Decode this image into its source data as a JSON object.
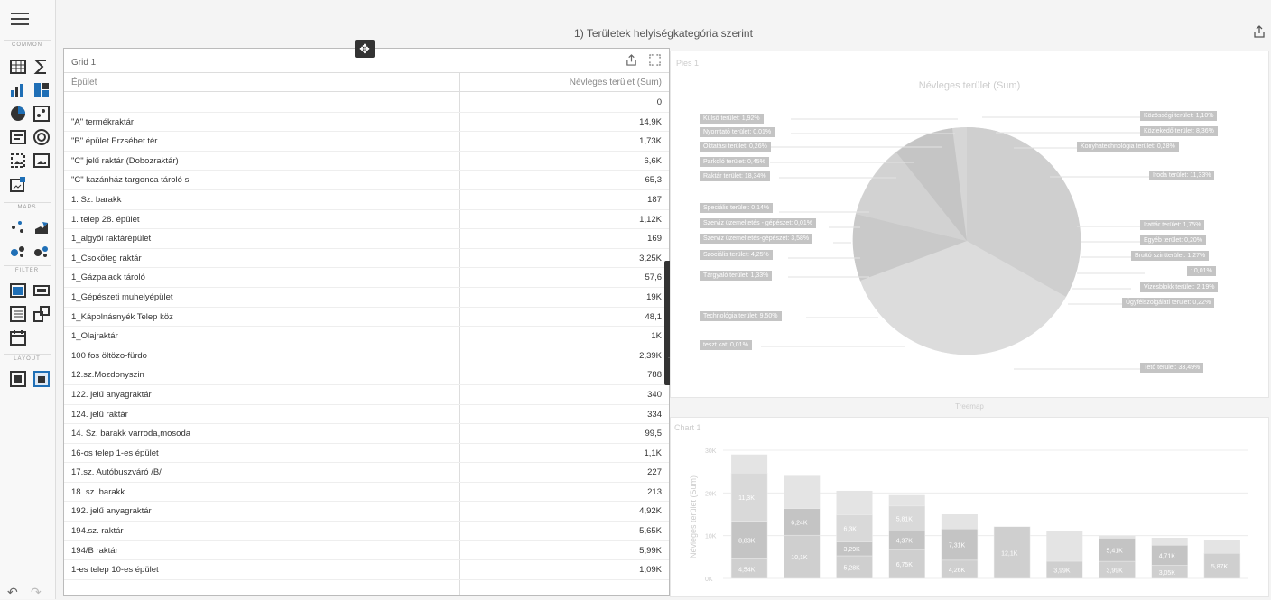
{
  "toolbox": {
    "sections": {
      "common": "COMMON",
      "maps": "MAPS",
      "filter": "FILTER",
      "layout": "LAYOUT"
    }
  },
  "dashboard": {
    "title": "1) Területek helyiségkategória szerint"
  },
  "grid": {
    "caption": "Grid 1",
    "col1": "Épület",
    "col2": "Névleges terület (Sum)",
    "rows": [
      {
        "name": "",
        "value": "0"
      },
      {
        "name": "\"A\" termékraktár",
        "value": "14,9K"
      },
      {
        "name": "\"B\" épület Erzsébet tér",
        "value": "1,73K"
      },
      {
        "name": "\"C\" jelű raktár (Dobozraktár)",
        "value": "6,6K"
      },
      {
        "name": "\"C\" kazánház targonca tároló s",
        "value": "65,3"
      },
      {
        "name": "1. Sz. barakk",
        "value": "187"
      },
      {
        "name": "1. telep 28. épület",
        "value": "1,12K"
      },
      {
        "name": "1_algyői raktárépület",
        "value": "169"
      },
      {
        "name": "1_Csoköteg raktár",
        "value": "3,25K"
      },
      {
        "name": "1_Gázpalack tároló",
        "value": "57,6"
      },
      {
        "name": "1_Gépészeti muhelyépület",
        "value": "19K"
      },
      {
        "name": "1_Kápolnásnyék Telep köz",
        "value": "48,1"
      },
      {
        "name": "1_Olajraktár",
        "value": "1K"
      },
      {
        "name": "100 fos öltözo-fürdo",
        "value": "2,39K"
      },
      {
        "name": "12.sz.Mozdonyszin",
        "value": "788"
      },
      {
        "name": "122. jelű anyagraktár",
        "value": "340"
      },
      {
        "name": "124. jelű raktár",
        "value": "334"
      },
      {
        "name": "14. Sz. barakk varroda,mosoda",
        "value": "99,5"
      },
      {
        "name": "16-os telep 1-es épület",
        "value": "1,1K"
      },
      {
        "name": "17.sz. Autóbuszváró /B/",
        "value": "227"
      },
      {
        "name": "18. sz. barakk",
        "value": "213"
      },
      {
        "name": "192. jelű anyagraktár",
        "value": "4,92K"
      },
      {
        "name": "194.sz. raktár",
        "value": "5,65K"
      },
      {
        "name": "194/B raktár",
        "value": "5,99K"
      },
      {
        "name": "1-es telep 10-es épület",
        "value": "1,09K"
      }
    ]
  },
  "pie": {
    "caption": "Pies 1",
    "title": "Névleges terület (Sum)",
    "labels_left": [
      "Külső terület: 1,92%",
      "Nyomtató terület: 0,01%",
      "Oktatási terület: 0,26%",
      "Parkoló terület: 0,45%",
      "Raktár terület: 18,34%",
      "Speciális terület: 0,14%",
      "Szerviz üzemeltetés - gépészet: 0,01%",
      "Szerviz üzemeltetés-gépészet: 3,58%",
      "Szociális terület: 4,25%",
      "Tárgyaló terület: 1,33%",
      "Technológia terület: 9,50%",
      "teszt kat: 0,01%"
    ],
    "labels_right": [
      "Közösségi terület: 1,10%",
      "Közlekedő terület: 8,36%",
      "Konyhatechnológia terület: 0,28%",
      "Iroda terület: 11,33%",
      "Irattár terület: 1,75%",
      "Egyéb terület: 0,20%",
      "Bruttó szintterület: 1,27%",
      ": 0,01%",
      "Vizesblokk terület: 2,19%",
      "Ügyfélszolgálati terület: 0,22%",
      "Tető terület: 33,49%"
    ]
  },
  "treemap": {
    "tab": "Treemap"
  },
  "chart1": {
    "caption": "Chart 1"
  },
  "chart_data": {
    "type": "bar",
    "stacked": true,
    "ylabel": "Névleges terület (Sum)",
    "yticks": [
      "0K",
      "10K",
      "20K",
      "30K"
    ],
    "ylim": [
      0,
      30000
    ],
    "totals": [
      29000,
      24000,
      20500,
      19500,
      15000,
      12000,
      11000,
      10000,
      9500,
      9000
    ],
    "segment_labels": [
      [
        "4,54K",
        "8,83K",
        "11,3K"
      ],
      [
        "10,1K",
        "6,24K"
      ],
      [
        "5,28K",
        "3,29K",
        "6,3K"
      ],
      [
        "6,75K",
        "4,37K",
        "5,81K"
      ],
      [
        "4,26K",
        "7,31K"
      ],
      [
        "12,1K"
      ],
      [
        "3,99K"
      ],
      [
        "3,99K",
        "5,41K"
      ],
      [
        "3,05K",
        "4,71K"
      ],
      [
        "5,87K"
      ]
    ],
    "segment_values": [
      [
        4540,
        8830,
        11300
      ],
      [
        10100,
        6240
      ],
      [
        5280,
        3290,
        6300
      ],
      [
        6750,
        4370,
        5810
      ],
      [
        4260,
        7310
      ],
      [
        12100
      ],
      [
        3990
      ],
      [
        3990,
        5410
      ],
      [
        3050,
        4710
      ],
      [
        5870
      ]
    ]
  }
}
